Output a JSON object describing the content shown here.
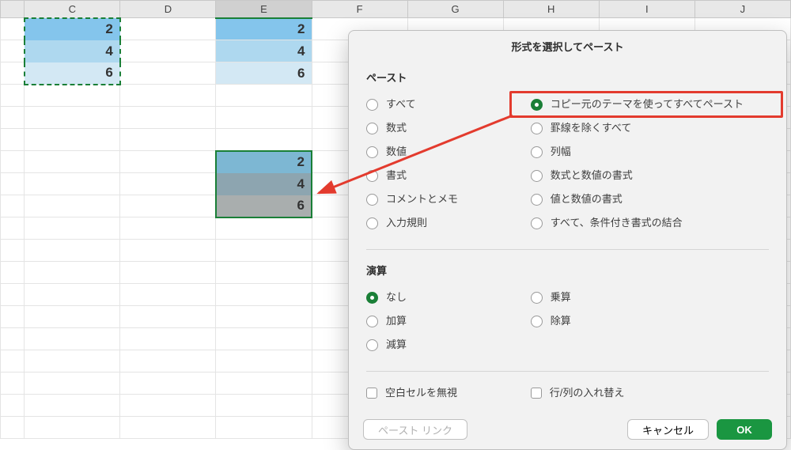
{
  "columns": [
    "C",
    "D",
    "E",
    "F",
    "G",
    "H",
    "I",
    "J"
  ],
  "active_column_index": 2,
  "source_cells": {
    "col": "C",
    "values": [
      2,
      4,
      6
    ],
    "colors": [
      "#84c5ec",
      "#aed8ef",
      "#d3e8f4"
    ]
  },
  "paste1": {
    "col": "E",
    "values": [
      2,
      4,
      6
    ],
    "colors": [
      "#84c5ec",
      "#aed8ef",
      "#d3e8f4"
    ]
  },
  "paste2": {
    "col": "E",
    "values": [
      2,
      4,
      6
    ],
    "colors": [
      "#7db7d3",
      "#8da5b0",
      "#a9aeae"
    ]
  },
  "dialog": {
    "title": "形式を選択してペースト",
    "paste_heading": "ペースト",
    "paste_options_left": [
      {
        "id": "all",
        "label": "すべて"
      },
      {
        "id": "formulas",
        "label": "数式"
      },
      {
        "id": "values",
        "label": "数値"
      },
      {
        "id": "formats",
        "label": "書式"
      },
      {
        "id": "comments",
        "label": "コメントとメモ"
      },
      {
        "id": "validation",
        "label": "入力規則"
      }
    ],
    "paste_options_right": [
      {
        "id": "theme",
        "label": "コピー元のテーマを使ってすべてペースト"
      },
      {
        "id": "noborder",
        "label": "罫線を除くすべて"
      },
      {
        "id": "colwidth",
        "label": "列幅"
      },
      {
        "id": "formnum",
        "label": "数式と数値の書式"
      },
      {
        "id": "valnum",
        "label": "値と数値の書式"
      },
      {
        "id": "condfmt",
        "label": "すべて、条件付き書式の結合"
      }
    ],
    "paste_selected": "theme",
    "op_heading": "演算",
    "op_options_left": [
      {
        "id": "none",
        "label": "なし"
      },
      {
        "id": "add",
        "label": "加算"
      },
      {
        "id": "sub",
        "label": "減算"
      }
    ],
    "op_options_right": [
      {
        "id": "mul",
        "label": "乗算"
      },
      {
        "id": "div",
        "label": "除算"
      }
    ],
    "op_selected": "none",
    "check_blank": "空白セルを無視",
    "check_transpose": "行/列の入れ替え",
    "btn_link": "ペースト リンク",
    "btn_cancel": "キャンセル",
    "btn_ok": "OK"
  }
}
